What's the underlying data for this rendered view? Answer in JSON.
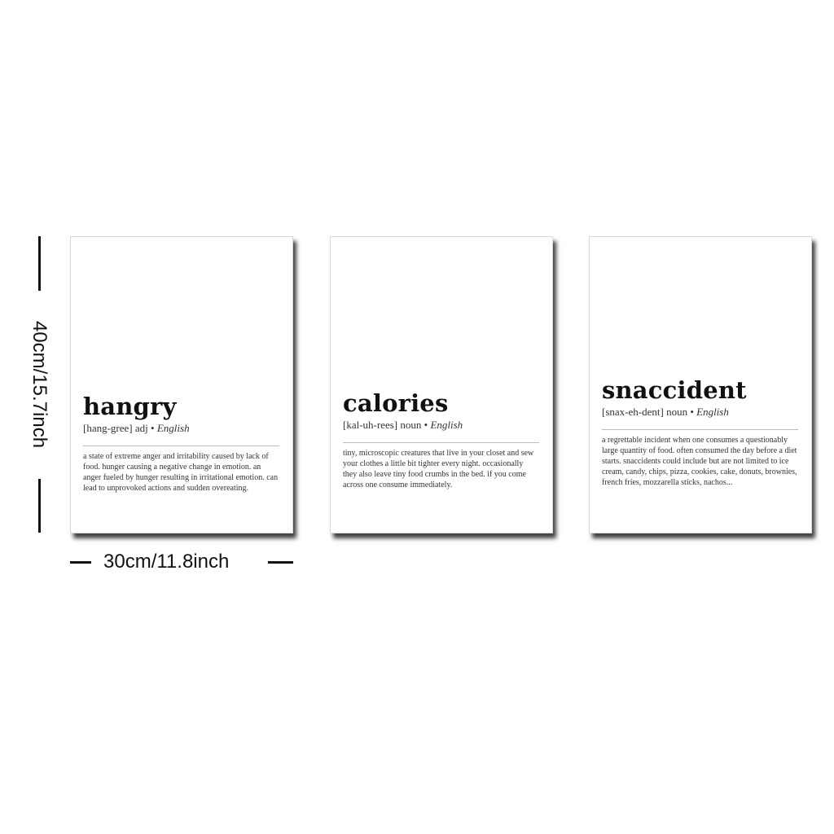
{
  "dimensions": {
    "height_label": "40cm/15.7inch",
    "width_label": "30cm/11.8inch"
  },
  "posters": [
    {
      "word": "hangry",
      "pronunciation": "[hang-gree]",
      "part_of_speech": "adj",
      "separator": "•",
      "language": "English",
      "definition": "a state of extreme anger and irritability caused by lack of food. hunger causing a negative change in emotion. an anger fueled by hunger resulting in irritational emotion. can lead to unprovoked actions and sudden overeating."
    },
    {
      "word": "calories",
      "pronunciation": "[kal-uh-rees]",
      "part_of_speech": "noun",
      "separator": "•",
      "language": "English",
      "definition": "tiny, microscopic creatures that live in your closet and sew your clothes a little bit tighter every night. occasionally they also leave tiny food crumbs in the bed. if you come across one consume immediately."
    },
    {
      "word": "snaccident",
      "pronunciation": "[snax-eh-dent]",
      "part_of_speech": "noun",
      "separator": "•",
      "language": "English",
      "definition": "a regrettable incident when one consumes a questionably large quantity of food. often consumed the day before a diet starts. snaccidents could include but are not limited to ice cream, candy, chips, pizza, cookies, cake, donuts, brownies, french fries, mozzarella sticks, nachos..."
    }
  ]
}
